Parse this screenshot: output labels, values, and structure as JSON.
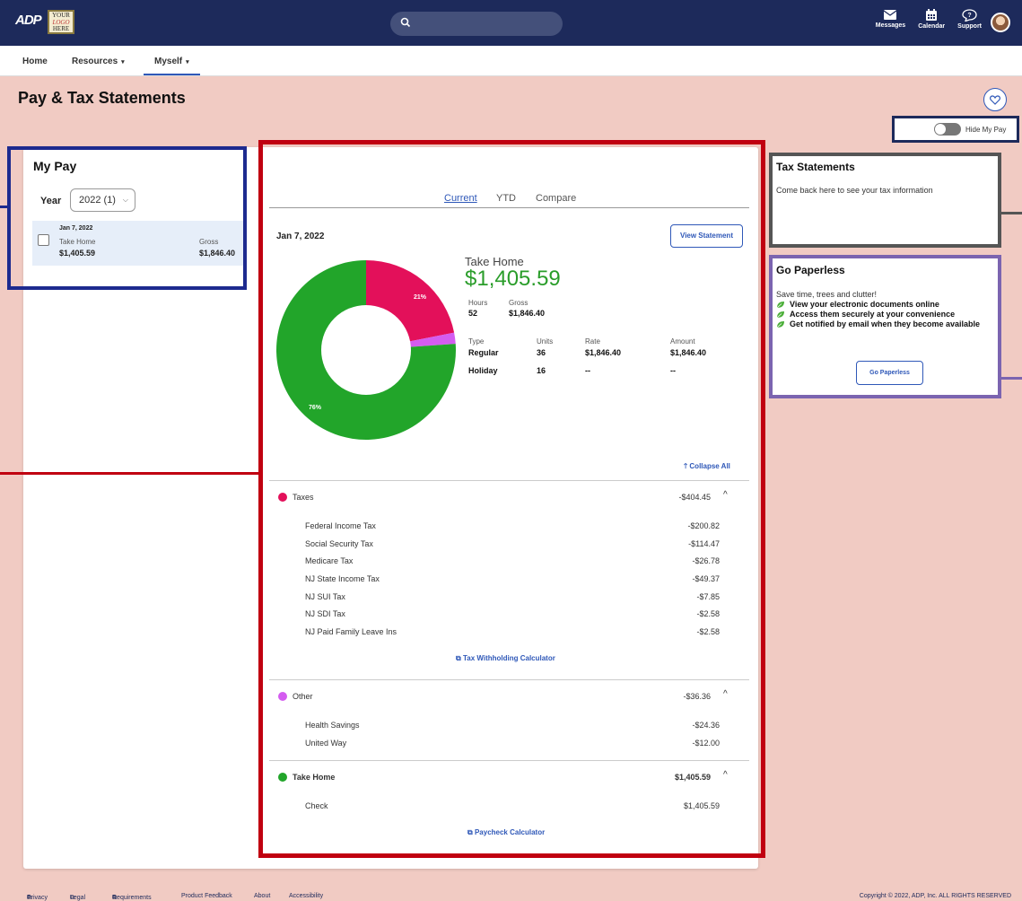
{
  "header": {
    "brand": "ADP",
    "company_logo": [
      "YOUR",
      "LOGO",
      "HERE"
    ],
    "search_placeholder": "",
    "icons": [
      {
        "name": "messages-icon",
        "label": "Messages"
      },
      {
        "name": "calendar-icon",
        "label": "Calendar"
      },
      {
        "name": "support-icon",
        "label": "Support"
      }
    ]
  },
  "nav": {
    "items": [
      {
        "label": "Home",
        "dropdown": false
      },
      {
        "label": "Resources",
        "dropdown": true
      },
      {
        "label": "Myself",
        "dropdown": true,
        "active": true
      }
    ]
  },
  "page": {
    "title": "Pay & Tax Statements",
    "hide_my_pay": "Hide My Pay"
  },
  "my_pay": {
    "title": "My Pay",
    "year_label": "Year",
    "year_value": "2022 (1)",
    "items": [
      {
        "date": "Jan 7, 2022",
        "take_home_label": "Take Home",
        "take_home": "$1,405.59",
        "gross_label": "Gross",
        "gross": "$1,846.40"
      }
    ]
  },
  "statement": {
    "tabs": [
      "Current",
      "YTD",
      "Compare"
    ],
    "active_tab": "Current",
    "date": "Jan 7, 2022",
    "view_button": "View Statement",
    "take_home_label": "Take Home",
    "take_home": "$1,405.59",
    "hours_label": "Hours",
    "hours": "52",
    "gross_label": "Gross",
    "gross": "$1,846.40",
    "earnings_headers": [
      "Type",
      "Units",
      "Rate",
      "Amount"
    ],
    "earnings": [
      {
        "type": "Regular",
        "units": "36",
        "rate": "$1,846.40",
        "amount": "$1,846.40"
      },
      {
        "type": "Holiday",
        "units": "16",
        "rate": "--",
        "amount": "--"
      }
    ],
    "collapse_all": "Collapse All",
    "taxes": {
      "title": "Taxes",
      "total": "-$404.45",
      "color": "#e3105a",
      "rows": [
        {
          "label": "Federal Income Tax",
          "amount": "-$200.82"
        },
        {
          "label": "Social Security Tax",
          "amount": "-$114.47"
        },
        {
          "label": "Medicare Tax",
          "amount": "-$26.78"
        },
        {
          "label": "NJ State Income Tax",
          "amount": "-$49.37"
        },
        {
          "label": "NJ SUI Tax",
          "amount": "-$7.85"
        },
        {
          "label": "NJ SDI Tax",
          "amount": "-$2.58"
        },
        {
          "label": "NJ Paid Family Leave Ins",
          "amount": "-$2.58"
        }
      ],
      "link": "Tax Withholding Calculator"
    },
    "other": {
      "title": "Other",
      "total": "-$36.36",
      "color": "#d45cf0",
      "rows": [
        {
          "label": "Health Savings",
          "amount": "-$24.36"
        },
        {
          "label": "United Way",
          "amount": "-$12.00"
        }
      ]
    },
    "take_home_section": {
      "title": "Take Home",
      "total": "$1,405.59",
      "color": "#22a52a",
      "rows": [
        {
          "label": "Check",
          "amount": "$1,405.59"
        }
      ],
      "link": "Paycheck Calculator"
    },
    "donut": {
      "slices": [
        {
          "name": "Taxes",
          "percent": 21.9,
          "label": "21%",
          "color": "#e3105a"
        },
        {
          "name": "Other",
          "percent": 2.0,
          "label": "",
          "color": "#d45cf0"
        },
        {
          "name": "Take Home",
          "percent": 76.1,
          "label": "76%",
          "color": "#22a52a"
        }
      ]
    }
  },
  "tax_statements": {
    "title": "Tax Statements",
    "text": "Come back here to see your tax information"
  },
  "paperless": {
    "title": "Go Paperless",
    "intro": "Save time, trees and clutter!",
    "bullets": [
      "View your electronic documents online",
      "Access them securely at your convenience",
      "Get notified by email when they become available"
    ],
    "button": "Go Paperless"
  },
  "footer": {
    "links": [
      "Privacy",
      "Legal",
      "Requirements",
      "Product Feedback",
      "About",
      "Accessibility"
    ],
    "copyright": "Copyright © 2022, ADP, Inc. ALL RIGHTS RESERVED"
  }
}
